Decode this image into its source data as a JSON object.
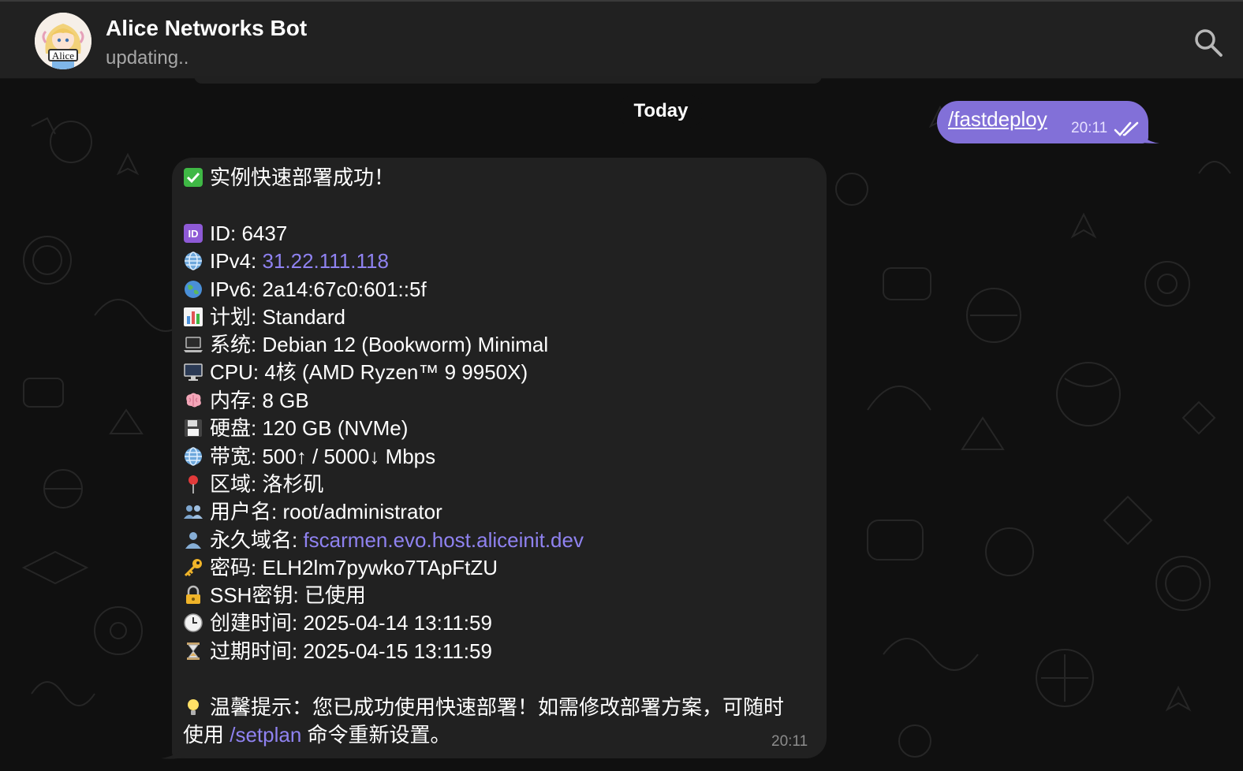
{
  "header": {
    "title": "Alice Networks Bot",
    "status": "updating..",
    "avatar_text": "Alice"
  },
  "chat": {
    "date_separator": "Today",
    "outgoing": {
      "command": "/fastdeploy",
      "time": "20:11"
    },
    "incoming": {
      "time": "20:11",
      "lines": [
        {
          "icon": "check-mark-button-icon",
          "text": "实例快速部署成功！"
        },
        {
          "icon": "id-icon",
          "label": "ID: ",
          "value": "6437"
        },
        {
          "icon": "globe-meridians-icon",
          "label": "IPv4: ",
          "value": "31.22.111.118",
          "link": true
        },
        {
          "icon": "earth-globe-icon",
          "label": "IPv6: ",
          "value": "2a14:67c0:601::5f"
        },
        {
          "icon": "bar-chart-icon",
          "label": "计划: ",
          "value": "Standard"
        },
        {
          "icon": "laptop-icon",
          "label": "系统: ",
          "value": "Debian 12 (Bookworm) Minimal"
        },
        {
          "icon": "desktop-computer-icon",
          "label": "CPU: ",
          "value": "4核 (AMD Ryzen™ 9 9950X)"
        },
        {
          "icon": "brain-icon",
          "label": "内存: ",
          "value": "8 GB"
        },
        {
          "icon": "floppy-disk-icon",
          "label": "硬盘: ",
          "value": "120 GB (NVMe)"
        },
        {
          "icon": "globe-meridians-icon",
          "label": "带宽: ",
          "value": "500↑ / 5000↓ Mbps"
        },
        {
          "icon": "round-pushpin-icon",
          "label": "区域: ",
          "value": "洛杉矶"
        },
        {
          "icon": "busts-icon",
          "label": "用户名: ",
          "value": "root/administrator"
        },
        {
          "icon": "bust-icon",
          "label": "永久域名: ",
          "value": "fscarmen.evo.host.aliceinit.dev",
          "link": true
        },
        {
          "icon": "key-icon",
          "label": "密码: ",
          "value": "ELH2lm7pywko7TApFtZU"
        },
        {
          "icon": "locked-with-key-icon",
          "label": "SSH密钥: ",
          "value": "已使用"
        },
        {
          "icon": "clock-icon",
          "label": "创建时间: ",
          "value": "2025-04-14 13:11:59"
        },
        {
          "icon": "hourglass-icon",
          "label": "过期时间: ",
          "value": "2025-04-15 13:11:59"
        }
      ],
      "tip": {
        "icon": "light-bulb-icon",
        "line1": "温馨提示：您已成功使用快速部署！如需修改部署方案，可随时",
        "line2_pre": "使用 ",
        "line2_link": "/setplan",
        "line2_post": " 命令重新设置。"
      }
    }
  },
  "colors": {
    "accent": "#8270d8",
    "link": "#8f82f0",
    "bubble": "#212121",
    "header": "#212121"
  }
}
